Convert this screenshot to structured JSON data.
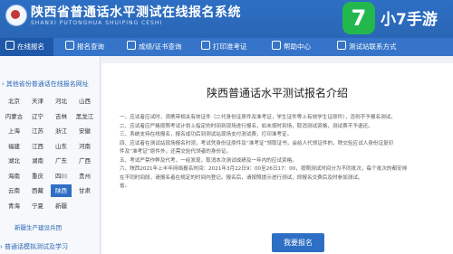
{
  "header": {
    "title": "陕西省普通话水平测试在线报名系统",
    "subtitle": "SHANXI PUTONGHUA SHUIPING CESHI",
    "badge_icon": "7",
    "badge_text": "小7手游",
    "colors": {
      "primary": "#2d6fc4",
      "badge": "#23b84e"
    }
  },
  "nav": {
    "items": [
      {
        "label": "在线报名",
        "icon": "home-icon"
      },
      {
        "label": "报名查询",
        "icon": "search-icon"
      },
      {
        "label": "成绩/证书查询",
        "icon": "certificate-icon"
      },
      {
        "label": "打印准考证",
        "icon": "print-icon"
      },
      {
        "label": "帮助中心",
        "icon": "help-icon"
      },
      {
        "label": "测试站联系方式",
        "icon": "contact-icon"
      }
    ]
  },
  "sidebar": {
    "heading": "其他省份普通话在线报名网址",
    "cities": [
      "北京",
      "天津",
      "河北",
      "山西",
      "内蒙古",
      "辽宁",
      "吉林",
      "黑龙江",
      "上海",
      "江苏",
      "浙江",
      "安徽",
      "福建",
      "江西",
      "山东",
      "河南",
      "湖北",
      "湖南",
      "广东",
      "广西",
      "海南",
      "重庆",
      "四川",
      "贵州",
      "云南",
      "西藏",
      "陕西",
      "甘肃",
      "青海",
      "宁夏",
      "新疆",
      ""
    ],
    "selected_city": "陕西",
    "link": "新疆生产建设兵团",
    "footer": "普通话模拟测试及学习"
  },
  "main": {
    "title": "陕西普通话水平测试报名介绍",
    "paragraphs": [
      "一、应试者应试时，须携带相关有效证件（二代身份证原件及准考证，学生证件等上有效学生证原件），否则不予报名测试。",
      "二、应试者应严格按照考试计划上指定的时间到现场进行报名，如未按时到场，取消测试资格，测试费不予退还。",
      "三、系统支持在线报名，报名成功后到测试站现场支付测试费，打印准考证。",
      "四、应试者在测试站现场报名时须，考试凭身份证原件及“准考证”领取证书，会给人代领证件的，除交验应试人身份证复印",
      "件及“准考证”原件外，还需交验代领者的身份证。",
      "五、考试严禁作弊及代考，一经发现，取消本次测试成绩及一年内的应试资格。",
      "六、陕西2021年上半年网络报名时间：2021年3月22日9：00至26日17：00，按照测试时间分为不同批次，每个批次的都安排",
      "在不同时间段，请报名者在规定的时间内登记。报名后，请按照提示进行测试，即报名交费后及时参加测试。",
      "省。"
    ],
    "apply_button": "我要报名"
  }
}
